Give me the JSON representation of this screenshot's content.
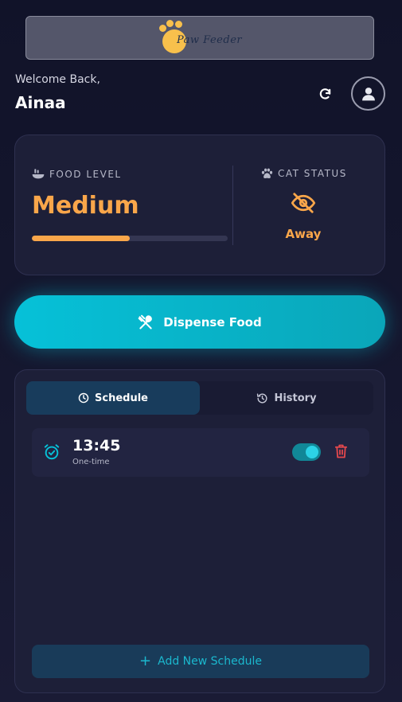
{
  "header": {
    "logo_text": "Paw Feeder",
    "welcome": "Welcome Back,",
    "username": "Ainaa",
    "refresh_icon": "refresh-icon",
    "avatar_icon": "user-icon"
  },
  "status_card": {
    "food_label": "FOOD LEVEL",
    "food_icon": "food-bowl-icon",
    "food_value": "Medium",
    "food_level_fraction": 0.5,
    "cat_label": "CAT STATUS",
    "cat_icon": "paw-icon",
    "cat_status_icon": "eye-slash-icon",
    "cat_value": "Away"
  },
  "dispense": {
    "label": "Dispense Food",
    "icon": "utensils-icon"
  },
  "tabs": [
    {
      "label": "Schedule",
      "icon": "clock-icon",
      "active": true
    },
    {
      "label": "History",
      "icon": "history-icon",
      "active": false
    }
  ],
  "schedules": [
    {
      "time": "13:45",
      "type": "One-time",
      "enabled": true,
      "icon": "alarm-clock-icon"
    }
  ],
  "add_button": {
    "label": "Add New Schedule",
    "icon": "plus-icon"
  },
  "colors": {
    "accent": "#06c1d8",
    "warning": "#f9a64a",
    "danger": "#e5484d",
    "background": "#111329",
    "card": "#1d1f38"
  }
}
